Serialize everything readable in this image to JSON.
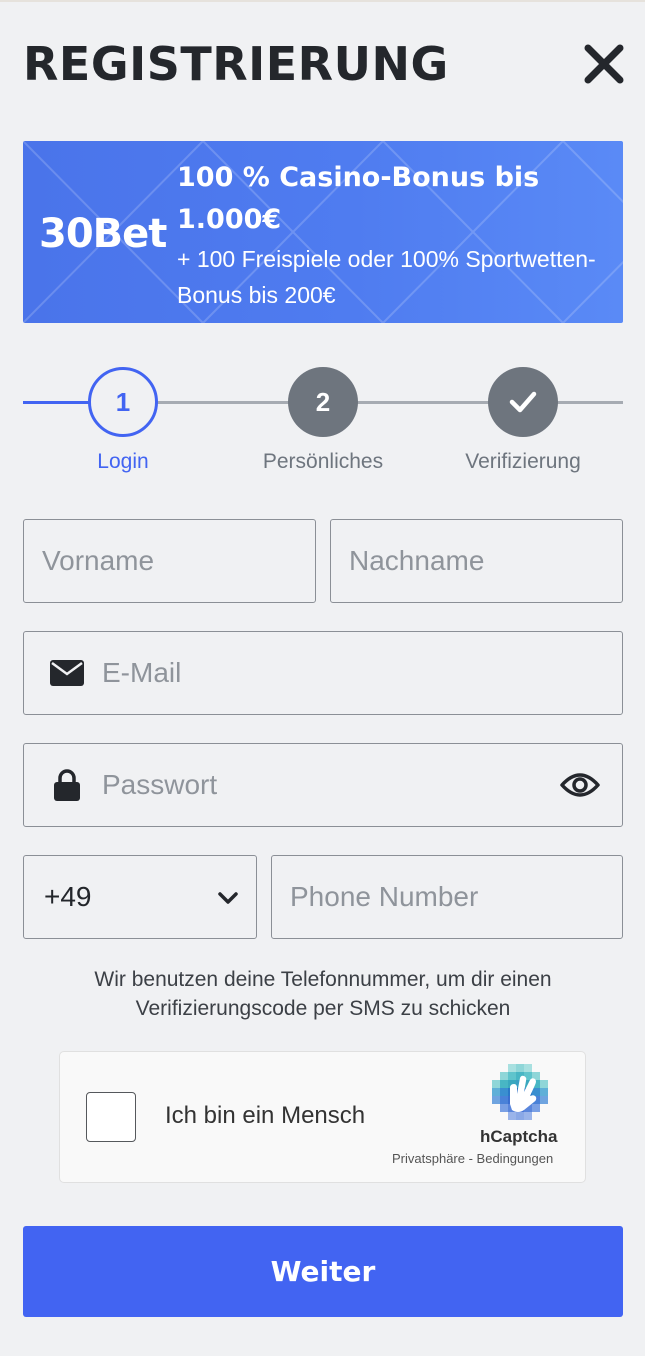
{
  "header": {
    "title": "REGISTRIERUNG",
    "close_icon": "close-icon"
  },
  "banner": {
    "logo_text": "30Bet",
    "title": "100 % Casino-Bonus bis 1.000€",
    "subtitle": "+ 100 Freispiele oder 100% Sportwetten-Bonus bis 200€"
  },
  "steps": [
    {
      "number": "1",
      "label": "Login",
      "state": "active"
    },
    {
      "number": "2",
      "label": "Persönliches",
      "state": "upcoming"
    },
    {
      "number": "",
      "label": "Verifizierung",
      "state": "upcoming",
      "icon": "check-icon"
    }
  ],
  "form": {
    "first_name_placeholder": "Vorname",
    "last_name_placeholder": "Nachname",
    "email_placeholder": "E-Mail",
    "password_placeholder": "Passwort",
    "phone_code": "+49",
    "phone_placeholder": "Phone Number",
    "phone_note": "Wir benutzen deine Telefonnummer, um dir einen Verifizierungscode per SMS zu schicken"
  },
  "captcha": {
    "label": "Ich bin ein Mensch",
    "brand": "hCaptcha",
    "privacy_link": "Privatsphäre",
    "separator": " - ",
    "terms_link": "Bedingungen"
  },
  "submit_label": "Weiter",
  "colors": {
    "accent": "#4264f2",
    "inactive_step": "#6e757e",
    "background": "#f0f1f3",
    "banner": "#4f7cf0"
  }
}
